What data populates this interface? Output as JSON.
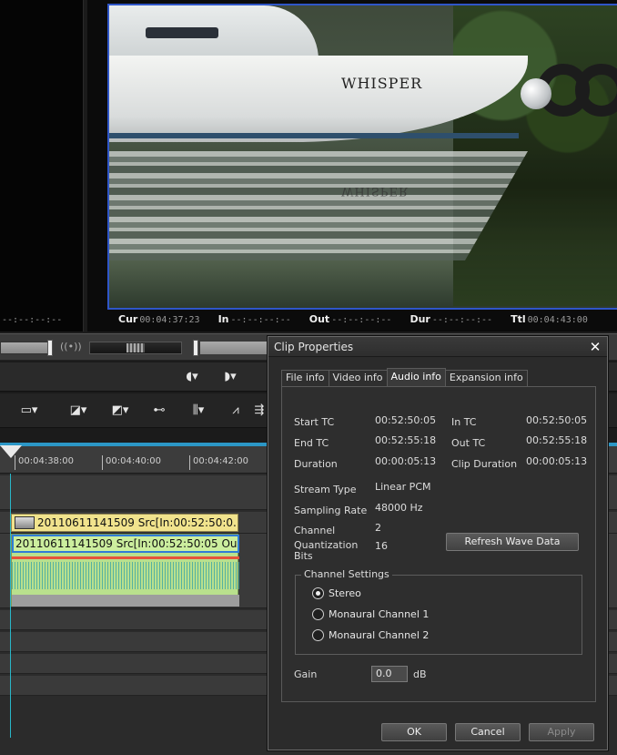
{
  "monitor": {
    "boat_name": "WHISPER",
    "left_tc": "--:--:--:--",
    "timecodes": [
      {
        "label": "Cur",
        "value": "00:04:37:23"
      },
      {
        "label": "In",
        "value": "--:--:--:--"
      },
      {
        "label": "Out",
        "value": "--:--:--:--"
      },
      {
        "label": "Dur",
        "value": "--:--:--:--"
      },
      {
        "label": "Ttl",
        "value": "00:04:43:00"
      }
    ]
  },
  "timeline": {
    "ticks": [
      "00:04:38:00",
      "00:04:40:00",
      "00:04:42:00"
    ],
    "video_clip": "20110611141509  Src[In:00:52:50:0...",
    "audio_clip": "20110611141509  Src[In:00:52:50:05 Ou..."
  },
  "dialog": {
    "title": "Clip Properties",
    "tabs": [
      "File info",
      "Video info",
      "Audio info",
      "Expansion info"
    ],
    "active_tab": "Audio info",
    "fields_left": [
      {
        "label": "Start TC",
        "value": "00:52:50:05"
      },
      {
        "label": "End TC",
        "value": "00:52:55:18"
      },
      {
        "label": "Duration",
        "value": "00:00:05:13"
      }
    ],
    "fields_right": [
      {
        "label": "In TC",
        "value": "00:52:50:05"
      },
      {
        "label": "Out TC",
        "value": "00:52:55:18"
      },
      {
        "label": "Clip Duration",
        "value": "00:00:05:13"
      }
    ],
    "stream": [
      {
        "label": "Stream Type",
        "value": "Linear PCM"
      },
      {
        "label": "Sampling Rate",
        "value": "48000 Hz"
      },
      {
        "label": "Channel",
        "value": "2"
      },
      {
        "label": "Quantization Bits",
        "value": "16"
      }
    ],
    "refresh_button": "Refresh Wave Data",
    "channel_settings": {
      "title": "Channel Settings",
      "options": [
        "Stereo",
        "Monaural Channel 1",
        "Monaural Channel 2"
      ],
      "selected": "Stereo"
    },
    "gain": {
      "label": "Gain",
      "value": "0.0",
      "unit": "dB"
    },
    "buttons": {
      "ok": "OK",
      "cancel": "Cancel",
      "apply": "Apply"
    }
  },
  "colors": {
    "accent": "#2f56c8",
    "playhead": "#29b6c8",
    "video_clip": "#f1e38d",
    "audio_clip": "#b9e08d"
  }
}
